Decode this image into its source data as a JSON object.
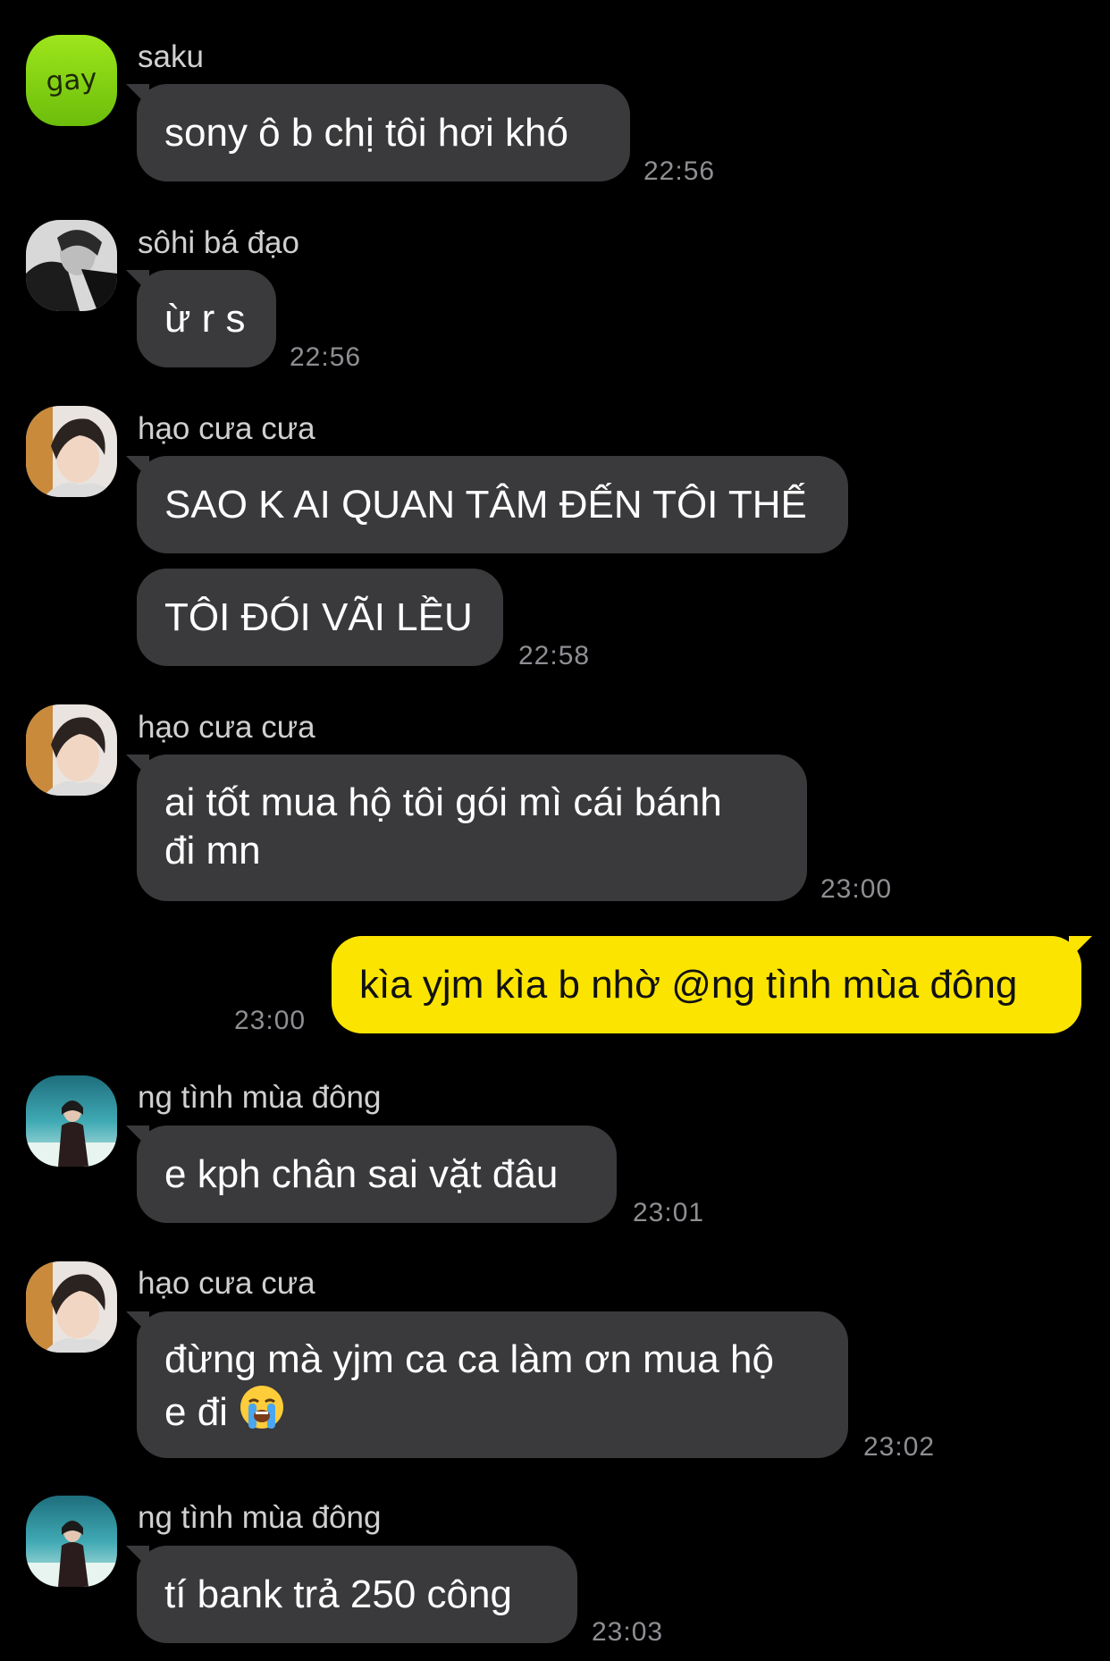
{
  "messages": [
    {
      "sender": "saku",
      "avatar": "gay-badge-avatar",
      "avatar_text": "gay",
      "text": "sony ô b chị tôi hơi khó",
      "time": "22:56"
    },
    {
      "sender": "sôhi bá đạo",
      "avatar": "bw-photo-avatar",
      "text": "ừ r s",
      "time": "22:56"
    },
    {
      "sender": "hạo cưa cưa",
      "avatar": "boy-photo-avatar",
      "text": "SAO K AI QUAN TÂM ĐẾN TÔI THẾ"
    },
    {
      "text": "TÔI ĐÓI VÃI LỀU",
      "time": "22:58"
    },
    {
      "sender": "hạo cưa cưa",
      "avatar": "boy-photo-avatar",
      "lines": [
        "ai tốt mua hộ tôi gói mì cái bánh",
        "đi mn"
      ],
      "time": "23:00"
    },
    {
      "mine": true,
      "text": "kìa yjm kìa b nhờ @ng tình mùa đông",
      "time": "23:00"
    },
    {
      "sender": "ng tình mùa đông",
      "avatar": "winter-photo-avatar",
      "text": "e kph chân sai vặt đâu",
      "time": "23:01"
    },
    {
      "sender": "hạo cưa cưa",
      "avatar": "boy-photo-avatar",
      "lines": [
        "đừng mà yjm ca ca làm ơn mua hộ",
        "e đi"
      ],
      "emoji": "loudly-crying-face",
      "time": "23:02"
    },
    {
      "sender": "ng tình mùa đông",
      "avatar": "winter-photo-avatar",
      "text": "tí bank trả 250 công",
      "time": "23:03"
    }
  ],
  "colors": {
    "background": "#000000",
    "bubble_other": "#3a3a3c",
    "bubble_mine": "#fbe400",
    "sender_name": "#d0d0d0",
    "timestamp": "#8e8e93",
    "avatar_green": "#7fcf12"
  }
}
